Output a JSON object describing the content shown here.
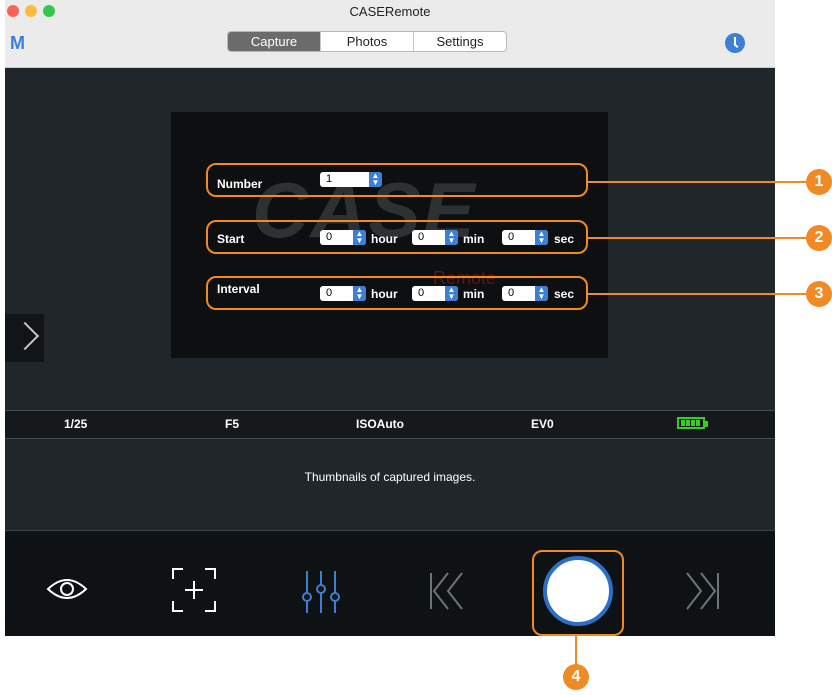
{
  "window": {
    "title": "CASERemote",
    "logo": "M"
  },
  "tabs": [
    "Capture",
    "Photos",
    "Settings"
  ],
  "form": {
    "number_label": "Number",
    "number_value": "1",
    "start_label": "Start",
    "interval_label": "Interval",
    "start": {
      "hour": "0",
      "min": "0",
      "sec": "0"
    },
    "interval": {
      "hour": "0",
      "min": "0",
      "sec": "0"
    },
    "units": {
      "hour": "hour",
      "min": "min",
      "sec": "sec"
    },
    "watermark": "CASE",
    "watermark_sub": "Remote"
  },
  "status": {
    "shutter": "1/25",
    "aperture": "F5",
    "iso": "ISOAuto",
    "ev": "EV0",
    "battery_icon": "battery-full-icon",
    "battery_level": 1.0
  },
  "thumbnails_text": "Thumbnails of captured images.",
  "callouts": [
    "1",
    "2",
    "3",
    "4"
  ],
  "toolbar_icons": [
    "eye-icon",
    "focus-icon",
    "sliders-icon",
    "skip-back-icon",
    "shutter-button",
    "skip-forward-icon"
  ],
  "colors": {
    "accent": "#3d7fd0",
    "callout": "#f08a24",
    "battery": "#3acb28"
  }
}
